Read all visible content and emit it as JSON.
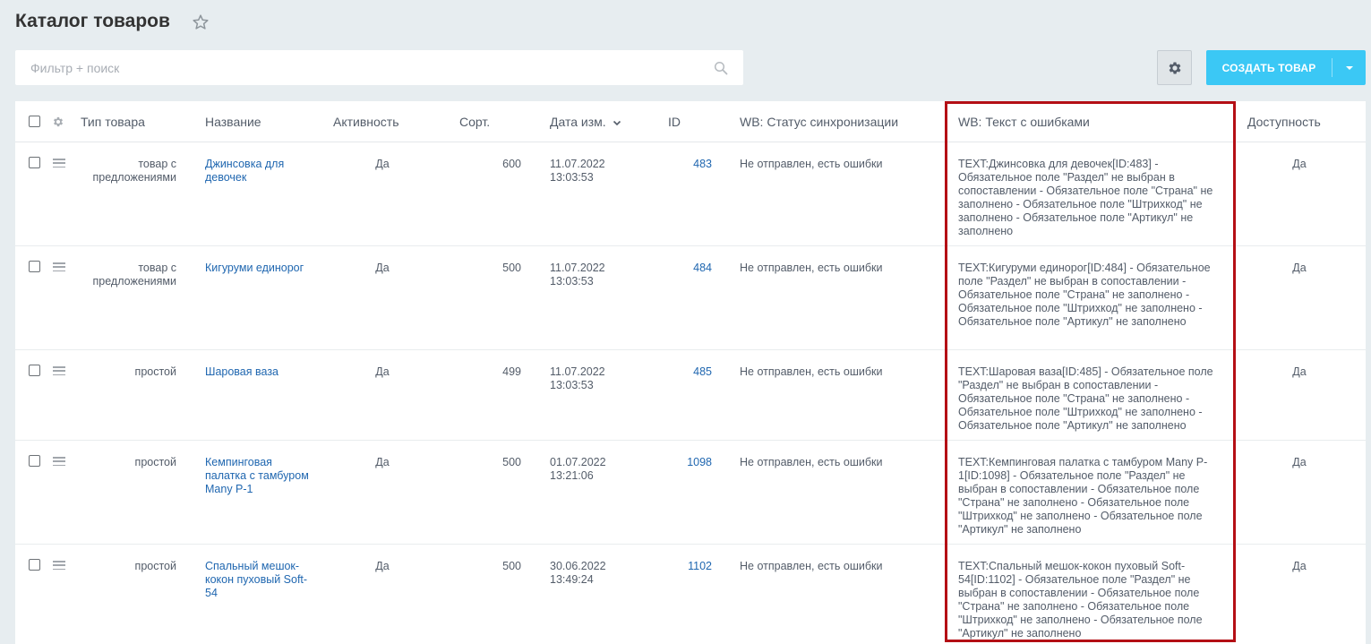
{
  "page": {
    "title": "Каталог товаров"
  },
  "filter": {
    "placeholder": "Фильтр + поиск"
  },
  "toolbar": {
    "create_label": "СОЗДАТЬ ТОВАР"
  },
  "columns": {
    "type": "Тип товара",
    "name": "Название",
    "active": "Активность",
    "sort": "Сорт.",
    "date": "Дата изм.",
    "id": "ID",
    "wb_status": "WB: Статус синхронизации",
    "wb_errors": "WB: Текст с ошибками",
    "availability": "Доступность"
  },
  "rows": [
    {
      "type": "товар с предложениями",
      "name": "Джинсовка для девочек",
      "active": "Да",
      "sort": "600",
      "date": "11.07.2022",
      "time": "13:03:53",
      "id": "483",
      "wb_status": "Не отправлен, есть ошибки",
      "wb_errors": "TEXT:Джинсовка для девочек[ID:483] - Обязательное поле \"Раздел\" не выбран в сопоставлении - Обязательное поле \"Страна\" не заполнено - Обязательное поле \"Штрихкод\" не заполнено - Обязательное поле \"Артикул\" не заполнено",
      "availability": "Да"
    },
    {
      "type": "товар с предложениями",
      "name": "Кигуруми единорог",
      "active": "Да",
      "sort": "500",
      "date": "11.07.2022",
      "time": "13:03:53",
      "id": "484",
      "wb_status": "Не отправлен, есть ошибки",
      "wb_errors": "TEXT:Кигуруми единорог[ID:484] - Обязательное поле \"Раздел\" не выбран в сопоставлении - Обязательное поле \"Страна\" не заполнено - Обязательное поле \"Штрихкод\" не заполнено - Обязательное поле \"Артикул\" не заполнено",
      "availability": "Да"
    },
    {
      "type": "простой",
      "name": "Шаровая ваза",
      "active": "Да",
      "sort": "499",
      "date": "11.07.2022",
      "time": "13:03:53",
      "id": "485",
      "wb_status": "Не отправлен, есть ошибки",
      "wb_errors": "TEXT:Шаровая ваза[ID:485] - Обязательное поле \"Раздел\" не выбран в сопоставлении - Обязательное поле \"Страна\" не заполнено - Обязательное поле \"Штрихкод\" не заполнено - Обязательное поле \"Артикул\" не заполнено",
      "availability": "Да"
    },
    {
      "type": "простой",
      "name": "Кемпинговая палатка с тамбуром Many P-1",
      "active": "Да",
      "sort": "500",
      "date": "01.07.2022",
      "time": "13:21:06",
      "id": "1098",
      "wb_status": "Не отправлен, есть ошибки",
      "wb_errors": "TEXT:Кемпинговая палатка с тамбуром Many P-1[ID:1098] - Обязательное поле \"Раздел\" не выбран в сопоставлении - Обязательное поле \"Страна\" не заполнено - Обязательное поле \"Штрихкод\" не заполнено - Обязательное поле \"Артикул\" не заполнено",
      "availability": "Да"
    },
    {
      "type": "простой",
      "name": "Спальный мешок-кокон пуховый Soft-54",
      "active": "Да",
      "sort": "500",
      "date": "30.06.2022",
      "time": "13:49:24",
      "id": "1102",
      "wb_status": "Не отправлен, есть ошибки",
      "wb_errors": "TEXT:Спальный мешок-кокон пуховый Soft-54[ID:1102] - Обязательное поле \"Раздел\" не выбран в сопоставлении - Обязательное поле \"Страна\" не заполнено - Обязательное поле \"Штрихкод\" не заполнено - Обязательное поле \"Артикул\" не заполнено",
      "availability": "Да"
    }
  ]
}
